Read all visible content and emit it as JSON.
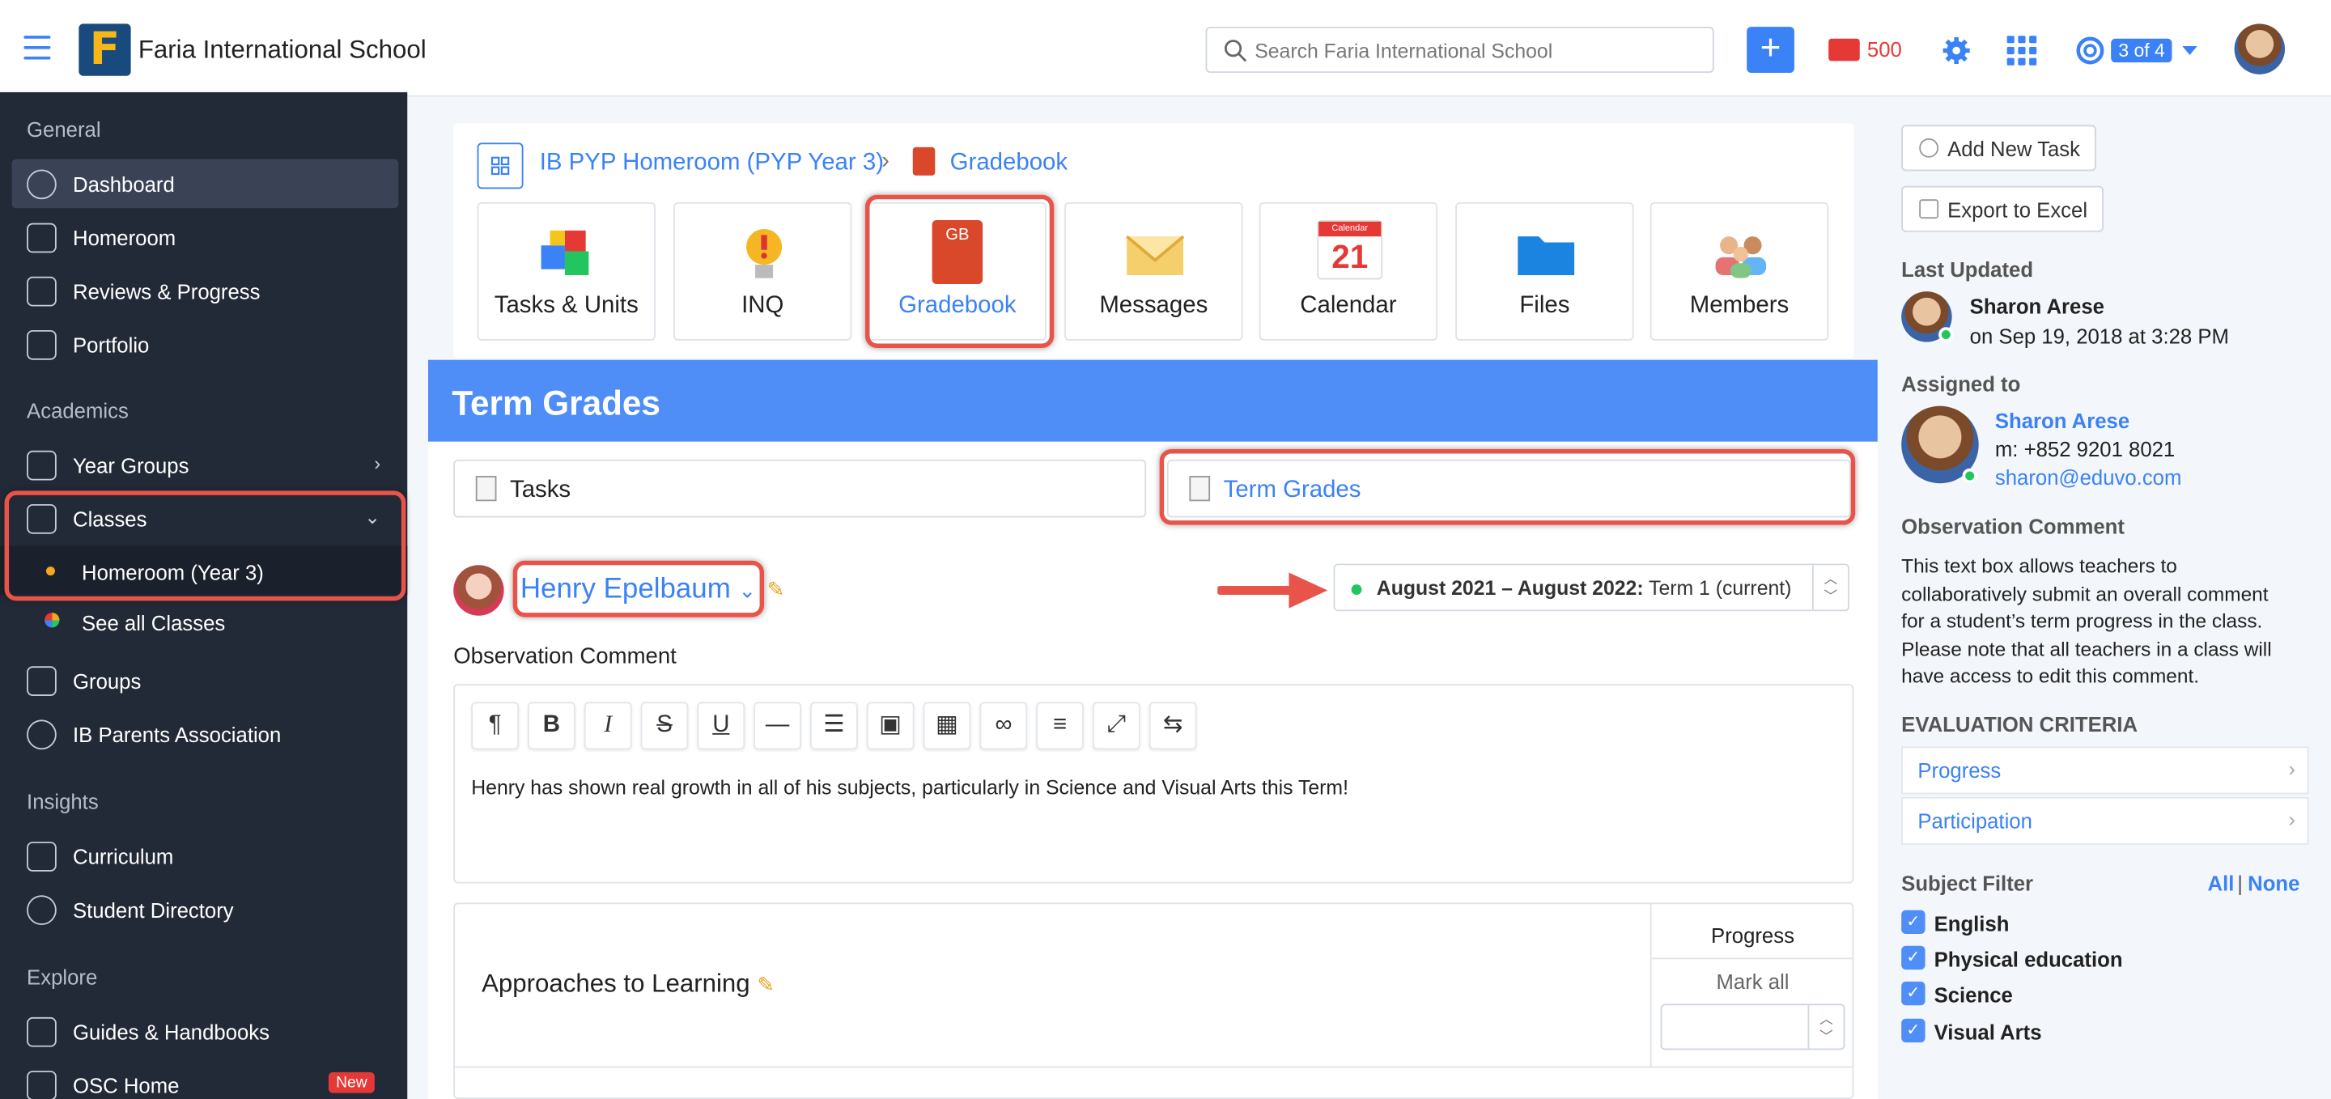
{
  "header": {
    "school": "Faria International School",
    "search_placeholder": "Search Faria International School",
    "mail_count": "500",
    "pager": "3 of 4"
  },
  "sidebar": {
    "general": "General",
    "academics": "Academics",
    "insights": "Insights",
    "explore": "Explore",
    "items": {
      "dashboard": "Dashboard",
      "homeroom": "Homeroom",
      "reviews": "Reviews & Progress",
      "portfolio": "Portfolio",
      "year_groups": "Year Groups",
      "classes": "Classes",
      "homeroom_y3": "Homeroom (Year 3)",
      "see_all": "See all Classes",
      "groups": "Groups",
      "ib_parents": "IB Parents Association",
      "curriculum": "Curriculum",
      "student_dir": "Student Directory",
      "guides": "Guides & Handbooks",
      "osc": "OSC Home"
    },
    "new_badge": "New"
  },
  "main": {
    "crumb": "IB PYP Homeroom (PYP Year 3)",
    "crumb2": "Gradebook",
    "tiles": {
      "tasks": "Tasks & Units",
      "inq": "INQ",
      "gradebook": "Gradebook",
      "messages": "Messages",
      "calendar": "Calendar",
      "files": "Files",
      "members": "Members"
    },
    "calendar_day": "21",
    "calendar_month": "Calendar",
    "gb_label": "GB",
    "title": "Term Grades",
    "tab_tasks": "Tasks",
    "tab_term": "Term Grades",
    "student": "Henry Epelbaum",
    "term_bold": "August 2021 – August 2022:",
    "term_rest": " Term 1 (current)",
    "obs_label": "Observation Comment",
    "comment": "Henry has shown real growth in all of his subjects, particularly in Science and Visual Arts this Term!",
    "atl": "Approaches to Learning",
    "progress": "Progress",
    "mark_all": "Mark all"
  },
  "right": {
    "add_task": "Add New Task",
    "export": "Export to Excel",
    "last_updated": "Last Updated",
    "lu_name": "Sharon Arese",
    "lu_date": "on Sep 19, 2018 at 3:28 PM",
    "assigned": "Assigned to",
    "as_name": "Sharon Arese",
    "as_phone": "m: +852 9201 8021",
    "as_email": "sharon@eduvo.com",
    "obs_title": "Observation Comment",
    "obs_text": [
      "This text box allows teachers to",
      "collaboratively submit an overall comment",
      "for a student’s term progress in the class.",
      "Please note that all teachers in a class will",
      "have access to edit this comment."
    ],
    "eval": "EVALUATION CRITERIA",
    "crit1": "Progress",
    "crit2": "Participation",
    "filter": "Subject Filter",
    "all": "All",
    "sep": "|",
    "none": "None",
    "subjects": [
      "English",
      "Physical education",
      "Science",
      "Visual Arts"
    ]
  },
  "colors": {
    "accent": "#3b82f6",
    "sidebar": "#232a37",
    "highlight": "#e8534a"
  }
}
